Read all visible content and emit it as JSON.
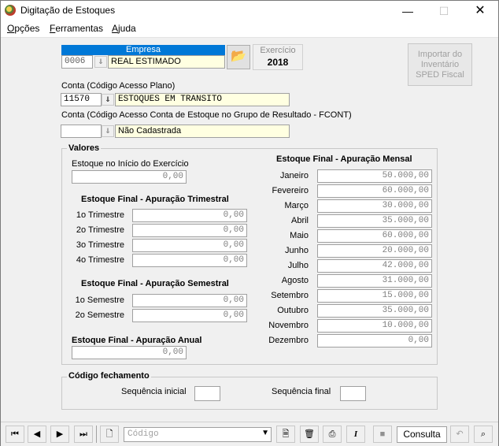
{
  "window": {
    "title": "Digitação de Estoques"
  },
  "menu": [
    {
      "label": "Opções",
      "mnemonic": "O"
    },
    {
      "label": "Ferramentas",
      "mnemonic": "F"
    },
    {
      "label": "Ajuda",
      "mnemonic": "A"
    }
  ],
  "empresa": {
    "header": "Empresa",
    "code": "0006",
    "name": "REAL ESTIMADO"
  },
  "exercicio": {
    "label": "Exercício",
    "year": "2018"
  },
  "import_button": {
    "label_line1": "Importar do",
    "label_line2": "Inventário",
    "label_line3": "SPED Fiscal"
  },
  "conta": {
    "label": "Conta (Código Acesso Plano)",
    "code": "11570",
    "name": "ESTOQUES EM TRANSITO"
  },
  "conta_fcont": {
    "label": "Conta (Código Acesso Conta de Estoque no Grupo de Resultado - FCONT)",
    "code": "",
    "name": "Não Cadastrada"
  },
  "valores": {
    "title": "Valores",
    "inicio_label": "Estoque no Início do Exercício",
    "inicio_value": "0,00",
    "trimestral": {
      "title": "Estoque Final - Apuração Trimestral",
      "rows": [
        {
          "label": "1o Trimestre",
          "value": "0,00"
        },
        {
          "label": "2o Trimestre",
          "value": "0,00"
        },
        {
          "label": "3o Trimestre",
          "value": "0,00"
        },
        {
          "label": "4o Trimestre",
          "value": "0,00"
        }
      ]
    },
    "semestral": {
      "title": "Estoque Final - Apuração Semestral",
      "rows": [
        {
          "label": "1o Semestre",
          "value": "0,00"
        },
        {
          "label": "2o Semestre",
          "value": "0,00"
        }
      ]
    },
    "anual": {
      "title": "Estoque Final - Apuração Anual",
      "value": "0,00"
    },
    "mensal": {
      "title": "Estoque Final - Apuração Mensal",
      "rows": [
        {
          "label": "Janeiro",
          "value": "50.000,00"
        },
        {
          "label": "Fevereiro",
          "value": "60.000,00"
        },
        {
          "label": "Março",
          "value": "30.000,00"
        },
        {
          "label": "Abril",
          "value": "35.000,00"
        },
        {
          "label": "Maio",
          "value": "60.000,00"
        },
        {
          "label": "Junho",
          "value": "20.000,00"
        },
        {
          "label": "Julho",
          "value": "42.000,00"
        },
        {
          "label": "Agosto",
          "value": "31.000,00"
        },
        {
          "label": "Setembro",
          "value": "15.000,00"
        },
        {
          "label": "Outubro",
          "value": "35.000,00"
        },
        {
          "label": "Novembro",
          "value": "10.000,00"
        },
        {
          "label": "Dezembro",
          "value": "0,00"
        }
      ]
    }
  },
  "fechamento": {
    "title": "Código fechamento",
    "inicial_label": "Sequência inicial",
    "inicial_value": "",
    "final_label": "Sequência final",
    "final_value": ""
  },
  "toolbar": {
    "search_placeholder": "Código",
    "mode_label": "Consulta"
  }
}
